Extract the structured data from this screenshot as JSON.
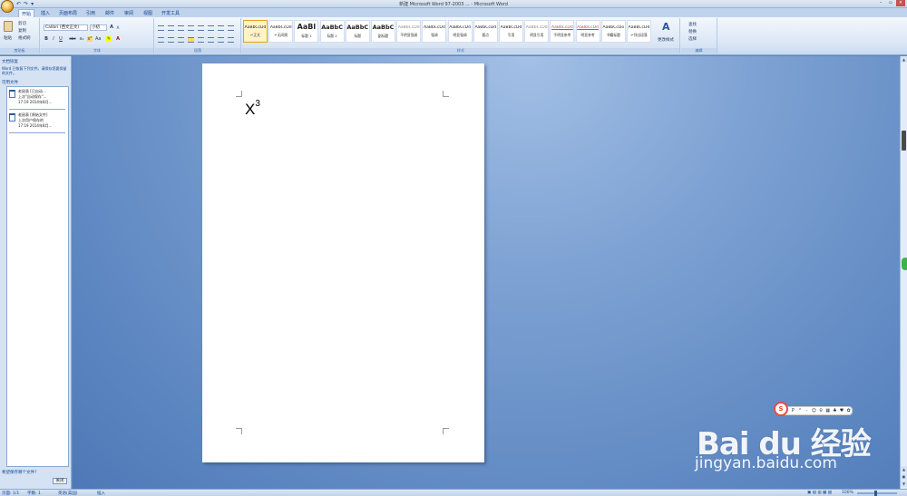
{
  "app": {
    "window_title": "新建 Microsoft Word 97-2003 ... - Microsoft Word",
    "quick_access": [
      "↶",
      "↷",
      "▾"
    ]
  },
  "ribbon": {
    "tabs": [
      "开始",
      "插入",
      "页面布局",
      "引用",
      "邮件",
      "审阅",
      "视图",
      "开发工具"
    ],
    "active_tab": "开始",
    "clipboard": {
      "paste": "粘贴",
      "cut": "剪切",
      "copy": "复制",
      "format_painter": "格式刷",
      "label": "剪贴板"
    },
    "font": {
      "font_name": "Calibri (西文正文)",
      "font_size": "小初",
      "label": "字体",
      "buttons": [
        "B",
        "I",
        "U",
        "abc",
        "x₂",
        "x²",
        "Aa",
        "A",
        "A"
      ]
    },
    "paragraph": {
      "label": "段落"
    },
    "styles": {
      "label": "样式",
      "items": [
        {
          "sample": "AaBbCcDd",
          "name": "↵正文",
          "kind": "normal"
        },
        {
          "sample": "AaBbCcDd",
          "name": "↵无间隔",
          "kind": "normal"
        },
        {
          "sample": "AaBl",
          "name": "标题 1",
          "kind": "big"
        },
        {
          "sample": "AaBbC",
          "name": "标题 2",
          "kind": "mid"
        },
        {
          "sample": "AaBbC",
          "name": "标题",
          "kind": "mid"
        },
        {
          "sample": "AaBbC",
          "name": "副标题",
          "kind": "mid"
        },
        {
          "sample": "AaBbCcDd",
          "name": "不明显强调",
          "kind": "muted"
        },
        {
          "sample": "AaBbCcDd",
          "name": "强调",
          "kind": "normal"
        },
        {
          "sample": "AaBbCcDd",
          "name": "明显强调",
          "kind": "normal"
        },
        {
          "sample": "AaBbCcDd",
          "name": "要点",
          "kind": "normal"
        },
        {
          "sample": "AaBbCcDd",
          "name": "引用",
          "kind": "normal"
        },
        {
          "sample": "AaBbCcDd",
          "name": "明显引用",
          "kind": "muted"
        },
        {
          "sample": "AaBbCcDd",
          "name": "不明显参考",
          "kind": "red"
        },
        {
          "sample": "AaBbCcDd",
          "name": "明显参考",
          "kind": "red"
        },
        {
          "sample": "AaBbCcDo",
          "name": "书籍标题",
          "kind": "normal"
        },
        {
          "sample": "AaBbCcDd",
          "name": "↵列出段落",
          "kind": "normal"
        }
      ],
      "change_styles": "更改样式"
    },
    "editing": {
      "label": "编辑",
      "find": "查找",
      "replace": "替换",
      "select": "选择"
    }
  },
  "left_pane": {
    "title": "文档恢复",
    "description": "Word 已恢复下列文件。请保存您要保留的文件。",
    "available_label": "可用文件",
    "files": [
      {
        "line1": "老鼠表 [已自动...",
        "line2": "上次\"自动保存\"...",
        "line3": "17:19 2014年8月..."
      },
      {
        "line1": "老鼠表 [原始文件]",
        "line2": "上次用户保存的",
        "line3": "17:19 2014年8月..."
      }
    ],
    "which_file": "希望保存哪个文件?",
    "close_button": "关闭"
  },
  "document": {
    "text": "X",
    "superscript": "3"
  },
  "status_bar": {
    "page": "页面: 1/1",
    "words": "字数: 1",
    "language": "英语(美国)",
    "insert_mode": "插入",
    "zoom": "100%"
  },
  "watermark": {
    "logo": "Bai du 经验",
    "url": "jingyan.baidu.com"
  },
  "ime_toolbar": {
    "items": [
      "P",
      "°",
      "·",
      "☺",
      "♀",
      "▦",
      "♣",
      "♥",
      "✿"
    ]
  }
}
